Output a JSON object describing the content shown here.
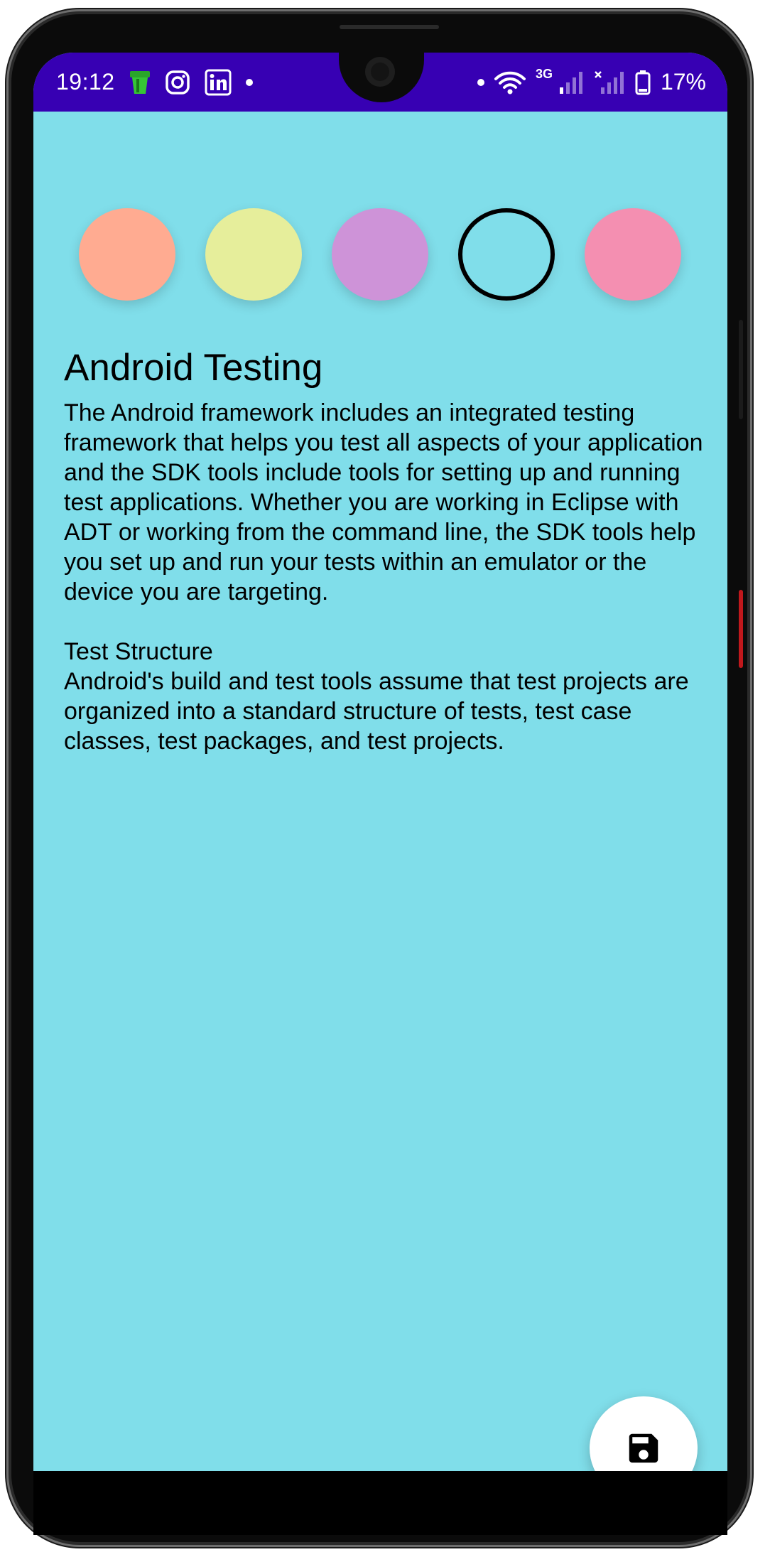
{
  "status_bar": {
    "time": "19:12",
    "network_type": "3G",
    "battery_percent": "17%",
    "left_icons": [
      "bucket-app-icon",
      "instagram-icon",
      "linkedin-icon",
      "notification-dot"
    ],
    "right_icons": [
      "notification-dot",
      "wifi-icon",
      "signal-icon",
      "signal-no-service-icon",
      "battery-icon"
    ],
    "background_color": "#3700b3"
  },
  "color_picker": {
    "swatches": [
      {
        "name": "orange",
        "color": "#ffab91"
      },
      {
        "name": "yellow",
        "color": "#e6ee9b"
      },
      {
        "name": "purple",
        "color": "#ce93d8"
      },
      {
        "name": "cyan",
        "color": "#80deea"
      },
      {
        "name": "pink",
        "color": "#f48fb1"
      }
    ],
    "selected_index": 3
  },
  "note": {
    "title": "Android Testing",
    "body": "The Android framework includes an integrated testing framework that helps you test all aspects of your application and the SDK tools include tools for setting up and running test applications. Whether you are working in Eclipse with ADT or working from the command line, the SDK tools help you set up and run your tests within an emulator or the device you are targeting.\n\nTest Structure\nAndroid's build and test tools assume that test projects are organized into a standard structure of tests, test case classes, test packages, and test projects.",
    "background_color": "#80deea"
  },
  "fab": {
    "icon": "save-icon"
  }
}
